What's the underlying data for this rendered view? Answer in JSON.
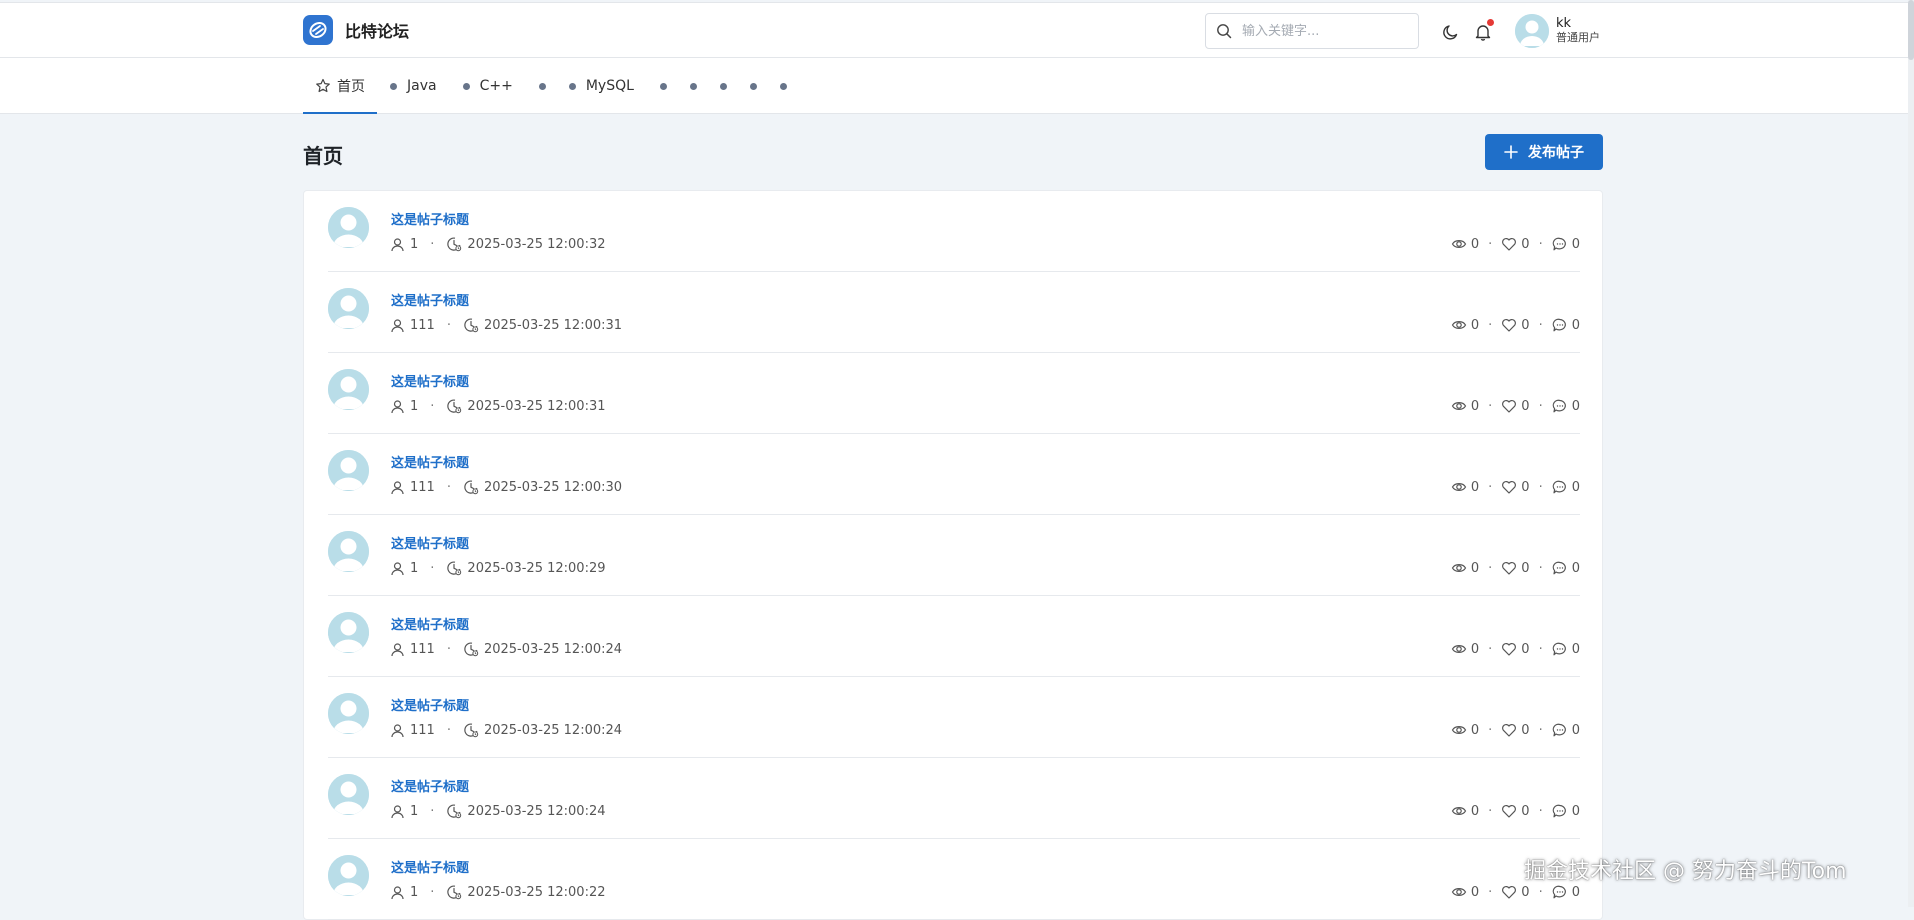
{
  "header": {
    "brand_name": "比特论坛",
    "search_placeholder": "输入关键字...",
    "user": {
      "name": "kk",
      "role": "普通用户"
    }
  },
  "nav": {
    "items": [
      {
        "label": "首页",
        "active": true
      },
      {
        "label": "Java"
      },
      {
        "label": "C++"
      },
      {
        "label": ""
      },
      {
        "label": "MySQL"
      },
      {
        "label": ""
      },
      {
        "label": ""
      },
      {
        "label": ""
      },
      {
        "label": ""
      },
      {
        "label": ""
      }
    ]
  },
  "page": {
    "title": "首页",
    "publish_label": "发布帖子"
  },
  "posts": [
    {
      "title": "这是帖子标题",
      "author": "1",
      "time": "2025-03-25 12:00:32",
      "views": "0",
      "likes": "0",
      "comments": "0"
    },
    {
      "title": "这是帖子标题",
      "author": "111",
      "time": "2025-03-25 12:00:31",
      "views": "0",
      "likes": "0",
      "comments": "0"
    },
    {
      "title": "这是帖子标题",
      "author": "1",
      "time": "2025-03-25 12:00:31",
      "views": "0",
      "likes": "0",
      "comments": "0"
    },
    {
      "title": "这是帖子标题",
      "author": "111",
      "time": "2025-03-25 12:00:30",
      "views": "0",
      "likes": "0",
      "comments": "0"
    },
    {
      "title": "这是帖子标题",
      "author": "1",
      "time": "2025-03-25 12:00:29",
      "views": "0",
      "likes": "0",
      "comments": "0"
    },
    {
      "title": "这是帖子标题",
      "author": "111",
      "time": "2025-03-25 12:00:24",
      "views": "0",
      "likes": "0",
      "comments": "0"
    },
    {
      "title": "这是帖子标题",
      "author": "111",
      "time": "2025-03-25 12:00:24",
      "views": "0",
      "likes": "0",
      "comments": "0"
    },
    {
      "title": "这是帖子标题",
      "author": "1",
      "time": "2025-03-25 12:00:24",
      "views": "0",
      "likes": "0",
      "comments": "0"
    },
    {
      "title": "这是帖子标题",
      "author": "1",
      "time": "2025-03-25 12:00:22",
      "views": "0",
      "likes": "0",
      "comments": "0"
    }
  ],
  "watermark": "掘金技术社区 @ 努力奋斗的Tom",
  "colors": {
    "accent": "#1f6fc9",
    "badge": "#e53935",
    "background": "#f0f4f8"
  },
  "icons": {
    "brand": "forum-logo-icon",
    "search": "search-icon",
    "theme": "moon-icon",
    "notifications": "bell-icon",
    "home": "star-icon",
    "author": "user-icon",
    "time": "clock-icon",
    "views": "eye-icon",
    "likes": "heart-icon",
    "comments": "comment-icon"
  }
}
